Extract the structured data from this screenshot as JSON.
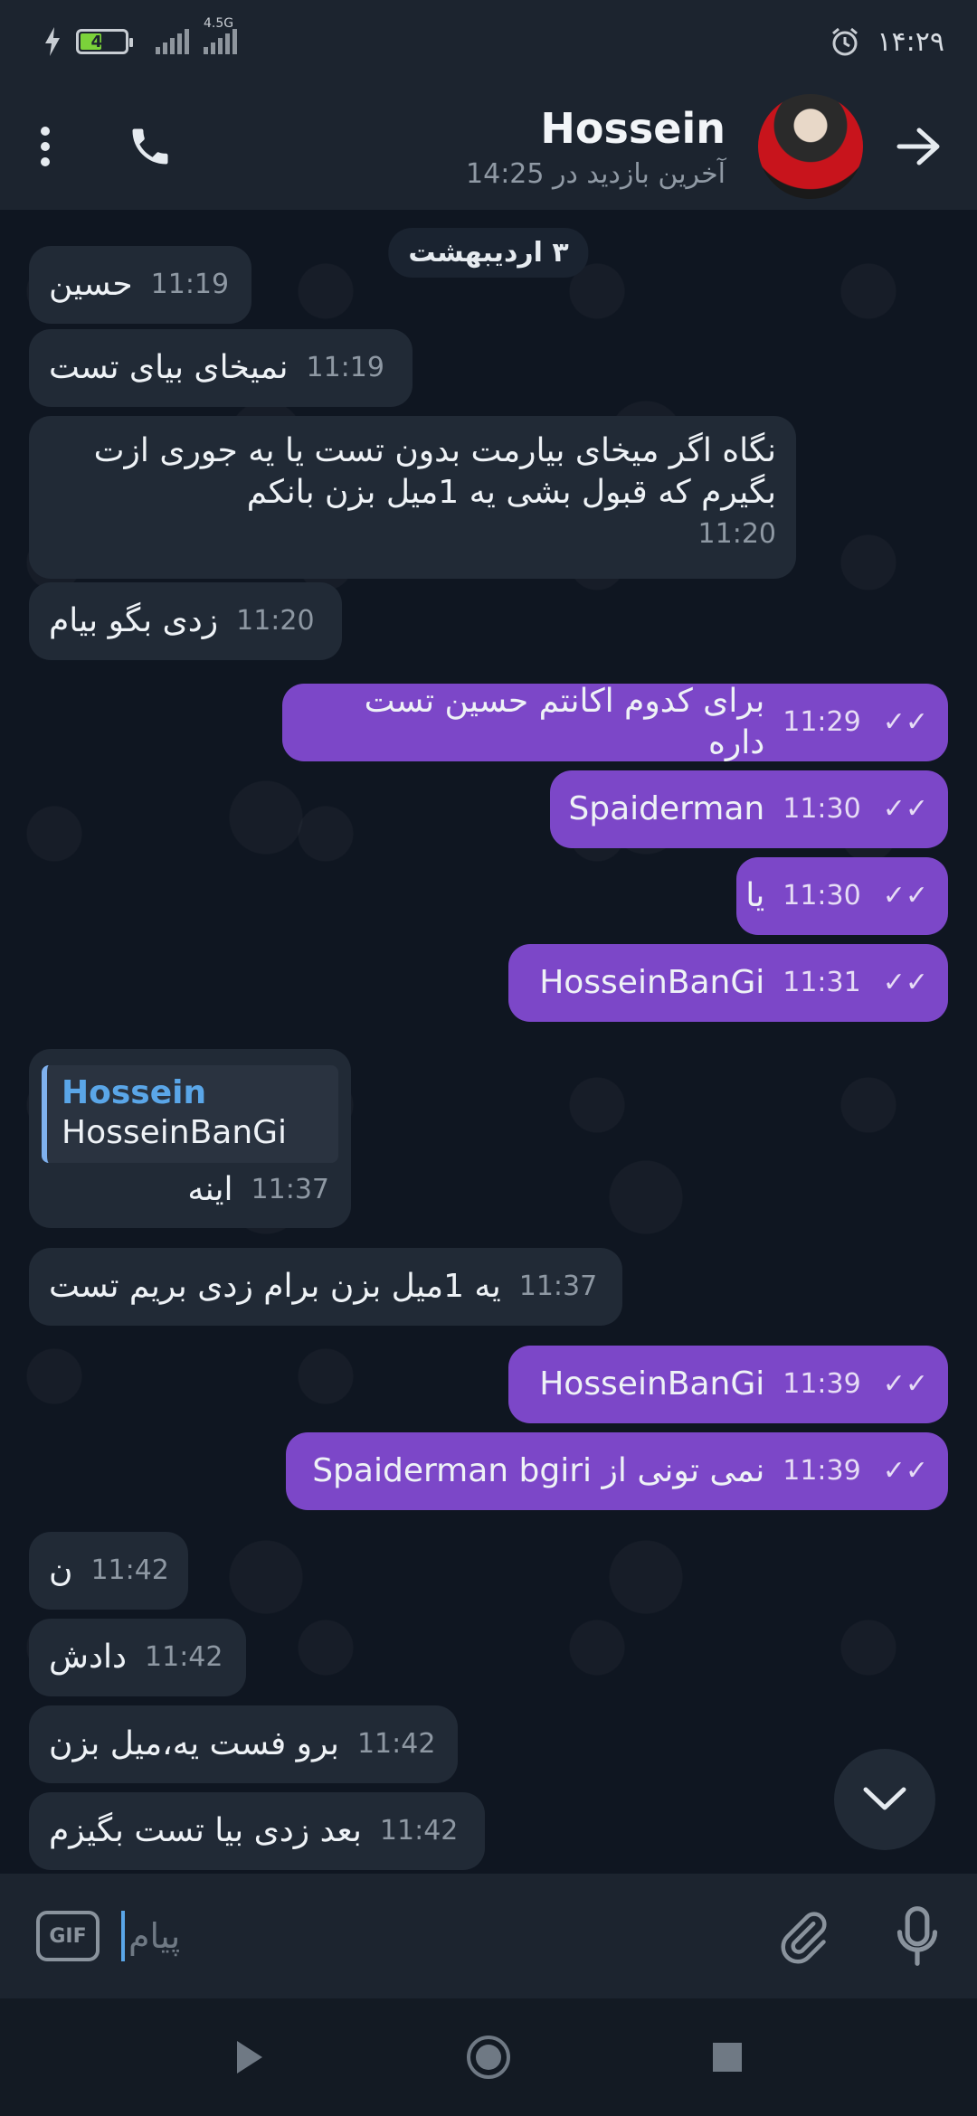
{
  "status_bar": {
    "battery_level": "44",
    "network_label": "4.5G",
    "clock": "۱۴:۲۹"
  },
  "header": {
    "name": "Hossein",
    "last_seen": "آخرین بازدید در 14:25"
  },
  "chat": {
    "date_chip": "۳ اردیبهشت",
    "messages": [
      {
        "text": "حسین",
        "time": "11:19"
      },
      {
        "text": "نمیخای بیای تست",
        "time": "11:19"
      },
      {
        "line1": "نگاه اگر میخای بیارمت بدون تست یا یه جوری ازت",
        "line2": "بگیرم که قبول بشی یه 1میل بزن بانکم",
        "time": "11:20"
      },
      {
        "text": "زدی بگو بیام",
        "time": "11:20"
      },
      {
        "text": "برای کدوم اکانتم حسین تست داره",
        "time": "11:29"
      },
      {
        "text": "Spaiderman",
        "time": "11:30"
      },
      {
        "text": "یا",
        "time": "11:30"
      },
      {
        "text": "HosseinBanGi",
        "time": "11:31"
      },
      {
        "reply_name": "Hossein",
        "reply_text": "HosseinBanGi",
        "text": "اینه",
        "time": "11:37"
      },
      {
        "text": "یه 1میل بزن برام زدی بریم تست",
        "time": "11:37"
      },
      {
        "text": "HosseinBanGi",
        "time": "11:39"
      },
      {
        "text": "نمی تونی از Spaiderman bgiri",
        "time": "11:39"
      },
      {
        "text": "ن",
        "time": "11:42"
      },
      {
        "text": "دادش",
        "time": "11:42"
      },
      {
        "text": "برو فست یه،میل بزن",
        "time": "11:42"
      },
      {
        "text": "بعد زدی بیا تست بگیزم",
        "time": "11:42"
      }
    ]
  },
  "composer": {
    "gif_label": "GIF",
    "placeholder": "پیام"
  },
  "colors": {
    "outgoing_bubble": "#7c47c8",
    "incoming_bubble": "#212a36",
    "reply_accent": "#5aa6e8"
  }
}
